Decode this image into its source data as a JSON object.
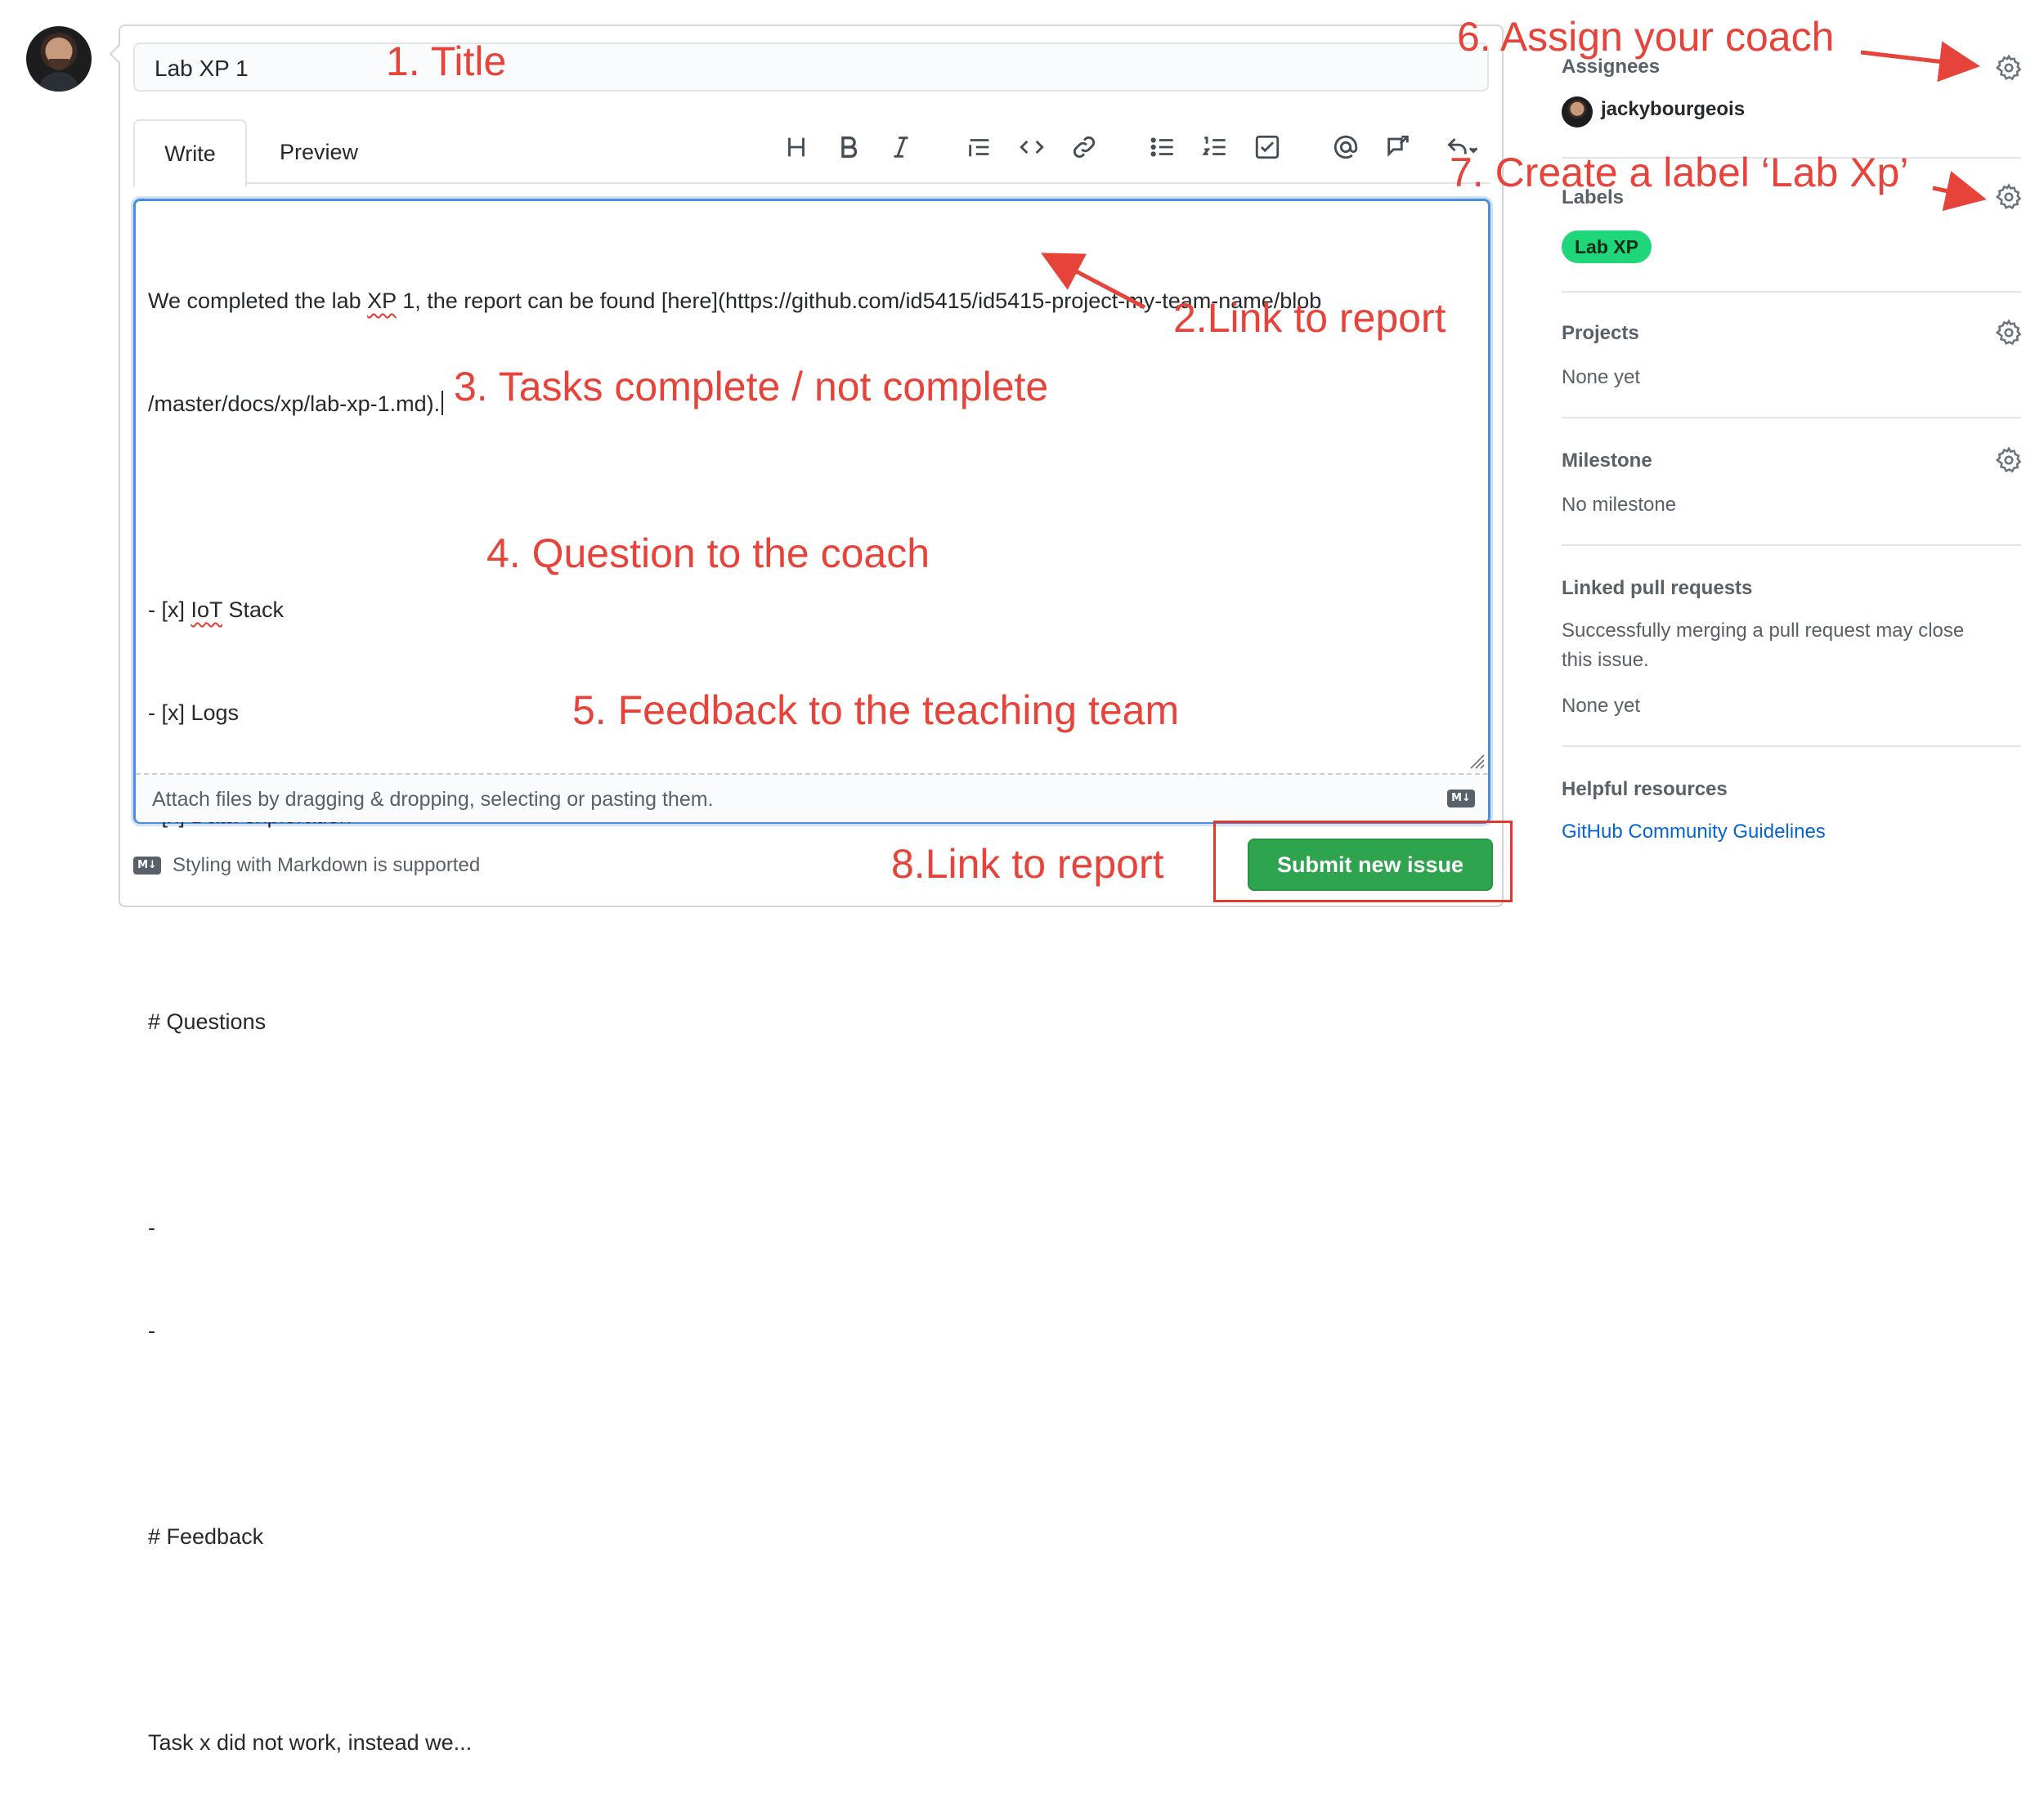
{
  "issue": {
    "title_value": "Lab XP 1"
  },
  "tabs": [
    {
      "label": "Write",
      "active": true
    },
    {
      "label": "Preview",
      "active": false
    }
  ],
  "toolbar": [
    {
      "icon": "heading-icon",
      "glyph": "H"
    },
    {
      "icon": "bold-icon",
      "glyph": "B"
    },
    {
      "icon": "italic-icon",
      "glyph": "I"
    },
    {
      "icon": "quote-icon"
    },
    {
      "icon": "code-icon"
    },
    {
      "icon": "link-icon"
    },
    {
      "icon": "bulleted-list-icon"
    },
    {
      "icon": "numbered-list-icon"
    },
    {
      "icon": "task-list-icon"
    },
    {
      "icon": "mention-icon"
    },
    {
      "icon": "reference-icon"
    },
    {
      "icon": "reply-dropdown-icon"
    }
  ],
  "editor": {
    "line1": "We completed the lab ",
    "line1_xp": "XP",
    "line1_rest": " 1, the report can be found [here](https://github.com/id5415/id5415-project-my-team-name/blob",
    "line2": "/master/docs/xp/lab-xp-1.md).",
    "task1_prefix": "- [x] ",
    "task1_iot": "IoT",
    "task1_rest": " Stack",
    "task2": "- [x] Logs",
    "task3": "- [x] Data exploration",
    "questions_heading": "# Questions",
    "q1": "-",
    "q2": "-",
    "feedback_heading": "# Feedback",
    "feedback_text": "Task x did not work, instead we..."
  },
  "attach_text": "Attach files by dragging & dropping, selecting or pasting them.",
  "markdown_badge": "M↓",
  "markdown_note": "Styling with Markdown is supported",
  "submit_label": "Submit new issue",
  "sidebar": {
    "assignees": {
      "title": "Assignees",
      "user": "jackybourgeois"
    },
    "labels": {
      "title": "Labels",
      "chip": "Lab XP",
      "chip_color": "#1fd67a"
    },
    "projects": {
      "title": "Projects",
      "value": "None yet"
    },
    "milestone": {
      "title": "Milestone",
      "value": "No milestone"
    },
    "linked_prs": {
      "title": "Linked pull requests",
      "desc_line1": "Successfully merging a pull request may close",
      "desc_line2": "this issue.",
      "value": "None yet"
    },
    "helpful": {
      "title": "Helpful resources",
      "link": "GitHub Community Guidelines"
    }
  },
  "annotations": {
    "a1": "1. Title",
    "a2": "2.Link to report",
    "a3": "3. Tasks complete / not complete",
    "a4": "4. Question to the coach",
    "a5": "5. Feedback to the teaching team",
    "a6": "6. Assign your coach",
    "a7": "7. Create a label  ‘Lab Xp’",
    "a8": "8.Link to report",
    "color": "#e6443a"
  }
}
